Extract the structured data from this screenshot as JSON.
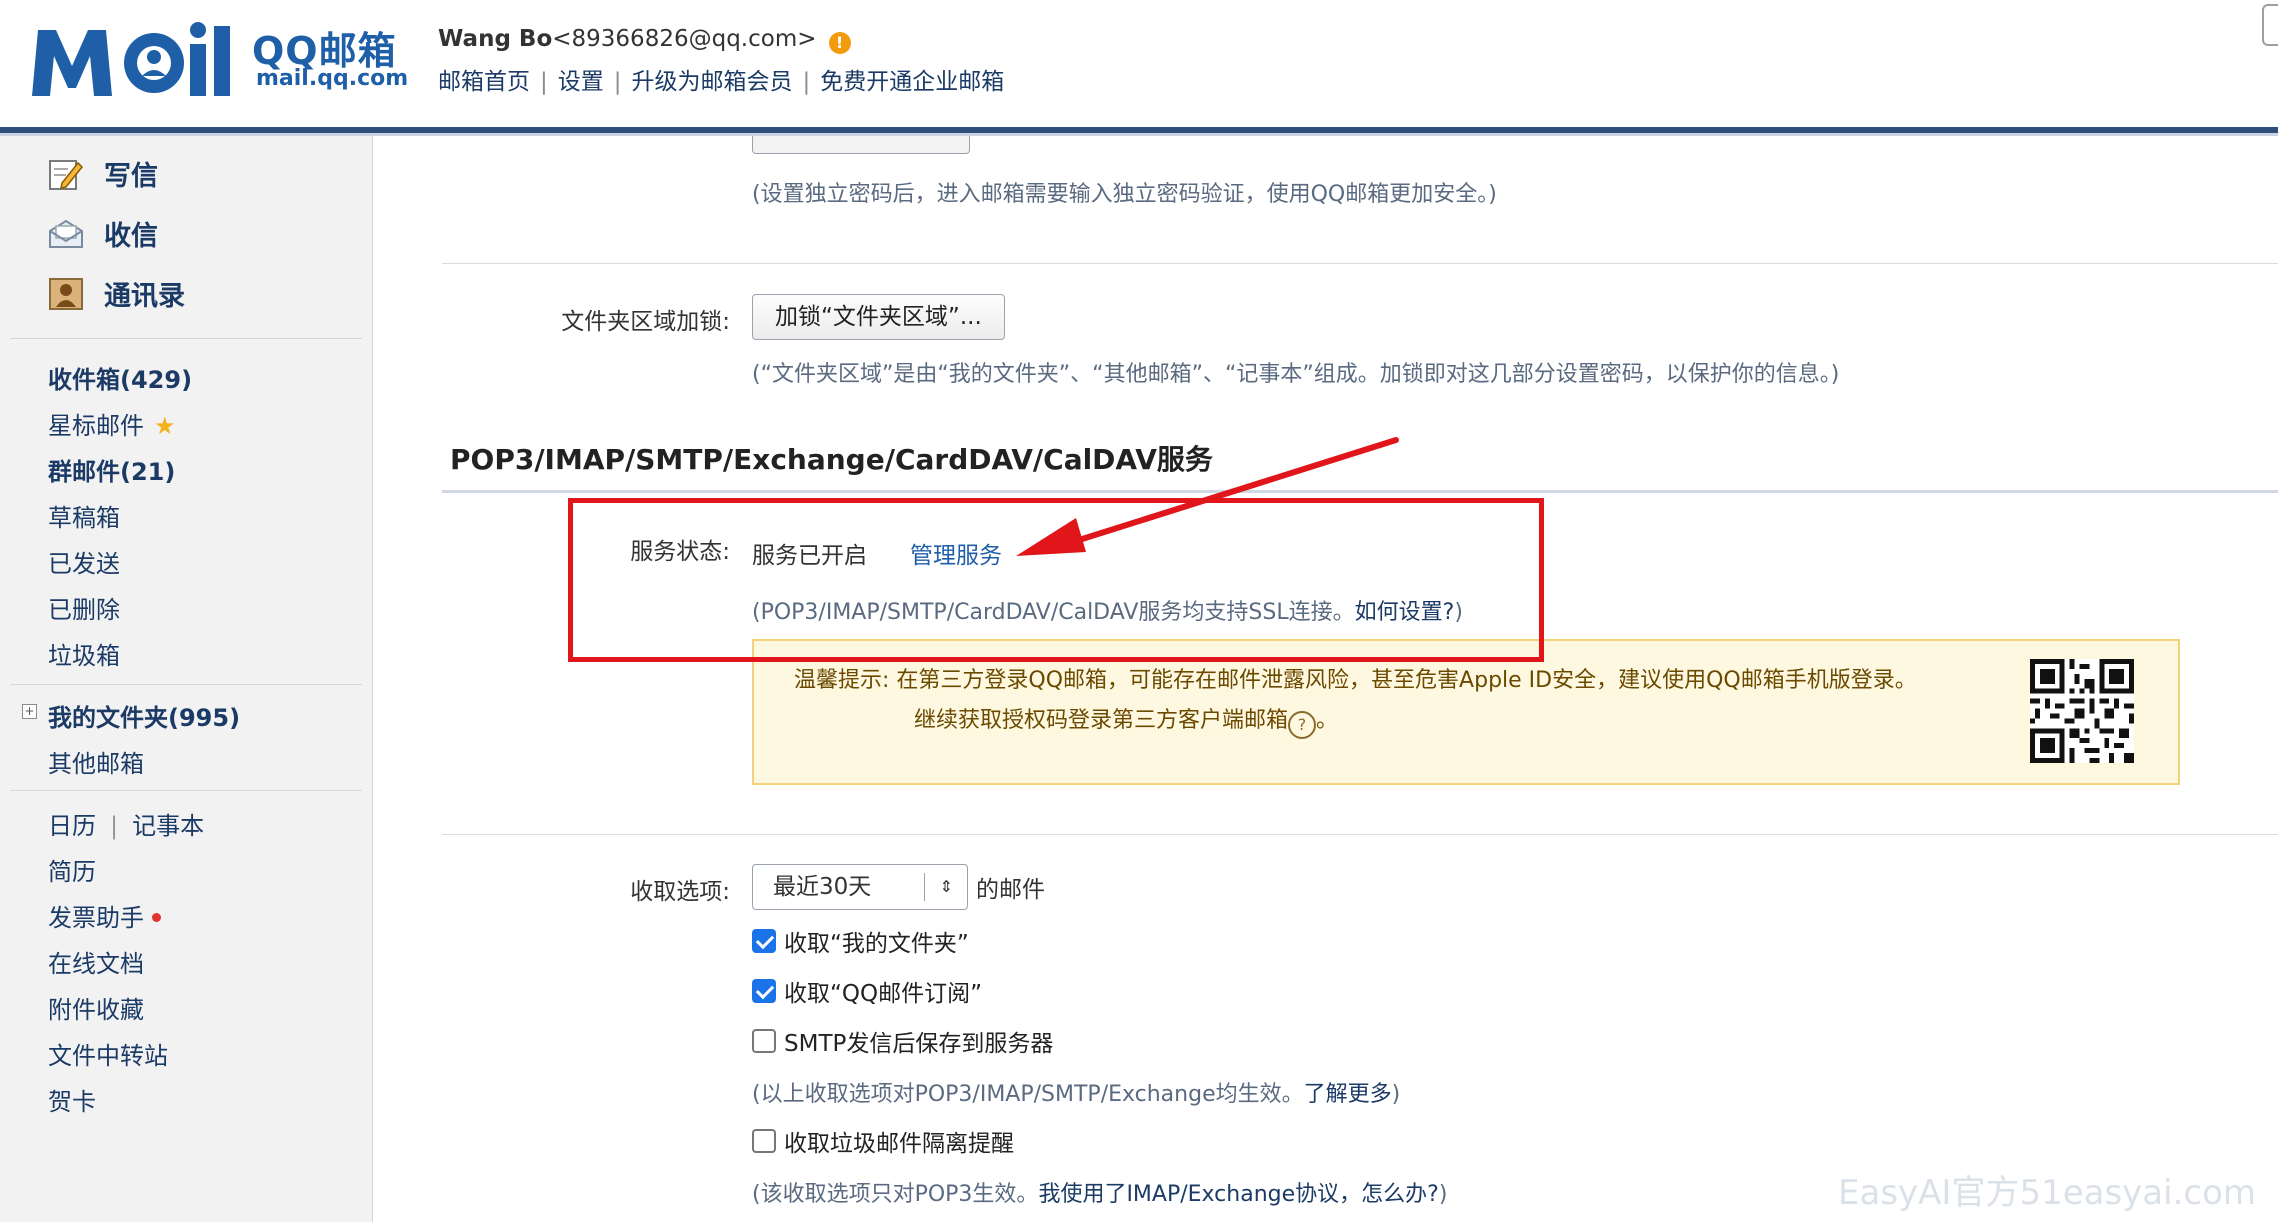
{
  "header": {
    "logo_cn": "QQ邮箱",
    "logo_en": "mail.qq.com",
    "user_name": "Wang Bo",
    "user_email": "<89366826@qq.com>",
    "links": [
      "邮箱首页",
      "设置",
      "升级为邮箱会员",
      "免费开通企业邮箱"
    ]
  },
  "sidebar": {
    "quick_actions": [
      {
        "label": "写信",
        "icon": "write-icon"
      },
      {
        "label": "收信",
        "icon": "inbox-envelope-icon"
      },
      {
        "label": "通讯录",
        "icon": "contacts-icon"
      }
    ],
    "folders": [
      {
        "label": "收件箱(429)",
        "bold": true
      },
      {
        "label": "星标邮件",
        "star": true
      },
      {
        "label": "群邮件(21)",
        "bold": true
      },
      {
        "label": "草稿箱"
      },
      {
        "label": "已发送"
      },
      {
        "label": "已删除"
      },
      {
        "label": "垃圾箱"
      }
    ],
    "my_folders": "我的文件夹(995)",
    "other_mail": "其他邮箱",
    "calendar": "日历",
    "notes": "记事本",
    "tools": [
      "简历",
      "发票助手",
      "在线文档",
      "附件收藏",
      "文件中转站",
      "贺卡"
    ]
  },
  "main": {
    "password_hint": "(设置独立密码后，进入邮箱需要输入独立密码验证，使用QQ邮箱更加安全。)",
    "folder_lock_label": "文件夹区域加锁:",
    "folder_lock_button": "加锁“文件夹区域”...",
    "folder_lock_hint": "(“文件夹区域”是由“我的文件夹”、“其他邮箱”、“记事本”组成。加锁即对这几部分设置密码，以保护你的信息。)",
    "section_title": "POP3/IMAP/SMTP/Exchange/CardDAV/CalDAV服务",
    "service_status_label": "服务状态:",
    "service_status_value": "服务已开启",
    "manage_service": "管理服务",
    "ssl_hint": "(POP3/IMAP/SMTP/CardDAV/CalDAV服务均支持SSL连接。",
    "ssl_hint_link": "如何设置?",
    "ssl_hint_end": ")",
    "tip_prefix": "温馨提示:",
    "tip_line1": "在第三方登录QQ邮箱，可能存在邮件泄露风险，甚至危害Apple ID安全，建议使用QQ邮箱手机版登录。",
    "tip_line2": "继续获取授权码登录第三方客户端邮箱",
    "tip_line2_end": "。",
    "receive_label": "收取选项:",
    "receive_select": "最近30天",
    "receive_suffix": "的邮件",
    "checkboxes": [
      {
        "label": "收取“我的文件夹”",
        "checked": true
      },
      {
        "label": "收取“QQ邮件订阅”",
        "checked": true
      },
      {
        "label": "SMTP发信后保存到服务器",
        "checked": false
      }
    ],
    "receive_hint": "(以上收取选项对POP3/IMAP/SMTP/Exchange均生效。",
    "receive_hint_link": "了解更多",
    "receive_hint_end": ")",
    "spam_checkbox": {
      "label": "收取垃圾邮件隔离提醒",
      "checked": false
    },
    "pop3_hint": "(该收取选项只对POP3生效。",
    "pop3_hint_link": "我使用了IMAP/Exchange协议，怎么办?",
    "pop3_hint_end": ")"
  },
  "watermark": "EasyAI官方51easyai.com",
  "colors": {
    "brand": "#1f5fa8",
    "annotation": "#e0161a",
    "tip_bg": "#fff8e1"
  }
}
